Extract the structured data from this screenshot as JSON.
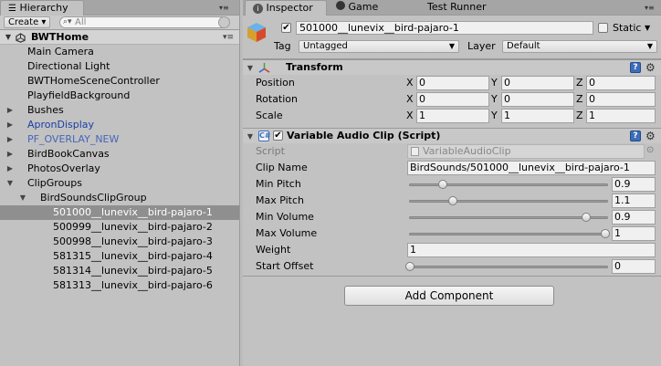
{
  "hierarchy": {
    "tab_label": "Hierarchy",
    "create_label": "Create ▾",
    "search_placeholder": "All",
    "scene_name": "BWTHome",
    "items": [
      {
        "label": "Main Camera",
        "indent": 1,
        "arrow": "",
        "color": "normal",
        "selected": false
      },
      {
        "label": "Directional Light",
        "indent": 1,
        "arrow": "",
        "color": "normal",
        "selected": false
      },
      {
        "label": "BWTHomeSceneController",
        "indent": 1,
        "arrow": "",
        "color": "normal",
        "selected": false
      },
      {
        "label": "PlayfieldBackground",
        "indent": 1,
        "arrow": "",
        "color": "normal",
        "selected": false
      },
      {
        "label": "Bushes",
        "indent": 1,
        "arrow": "▶",
        "color": "normal",
        "selected": false
      },
      {
        "label": "ApronDisplay",
        "indent": 1,
        "arrow": "▶",
        "color": "blue",
        "selected": false
      },
      {
        "label": "PF_OVERLAY_NEW",
        "indent": 1,
        "arrow": "▶",
        "color": "dimblue",
        "selected": false
      },
      {
        "label": "BirdBookCanvas",
        "indent": 1,
        "arrow": "▶",
        "color": "normal",
        "selected": false
      },
      {
        "label": "PhotosOverlay",
        "indent": 1,
        "arrow": "▶",
        "color": "normal",
        "selected": false
      },
      {
        "label": "ClipGroups",
        "indent": 1,
        "arrow": "▼",
        "color": "normal",
        "selected": false
      },
      {
        "label": "BirdSoundsClipGroup",
        "indent": 2,
        "arrow": "▼",
        "color": "normal",
        "selected": false
      },
      {
        "label": "501000__lunevix__bird-pajaro-1",
        "indent": 3,
        "arrow": "",
        "color": "normal",
        "selected": true
      },
      {
        "label": "500999__lunevix__bird-pajaro-2",
        "indent": 3,
        "arrow": "",
        "color": "normal",
        "selected": false
      },
      {
        "label": "500998__lunevix__bird-pajaro-3",
        "indent": 3,
        "arrow": "",
        "color": "normal",
        "selected": false
      },
      {
        "label": "581315__lunevix__bird-pajaro-4",
        "indent": 3,
        "arrow": "",
        "color": "normal",
        "selected": false
      },
      {
        "label": "581314__lunevix__bird-pajaro-5",
        "indent": 3,
        "arrow": "",
        "color": "normal",
        "selected": false
      },
      {
        "label": "581313__lunevix__bird-pajaro-6",
        "indent": 3,
        "arrow": "",
        "color": "normal",
        "selected": false
      }
    ]
  },
  "tabs": {
    "inspector": "Inspector",
    "game": "Game",
    "test_runner": "Test Runner"
  },
  "object": {
    "active": true,
    "name": "501000__lunevix__bird-pajaro-1",
    "static_label": "Static",
    "static_checked": false,
    "tag_label": "Tag",
    "tag_value": "Untagged",
    "layer_label": "Layer",
    "layer_value": "Default"
  },
  "transform": {
    "title": "Transform",
    "position_label": "Position",
    "rotation_label": "Rotation",
    "scale_label": "Scale",
    "x_label": "X",
    "y_label": "Y",
    "z_label": "Z",
    "position": {
      "x": "0",
      "y": "0",
      "z": "0"
    },
    "rotation": {
      "x": "0",
      "y": "0",
      "z": "0"
    },
    "scale": {
      "x": "1",
      "y": "1",
      "z": "1"
    }
  },
  "audio_clip": {
    "title": "Variable Audio Clip (Script)",
    "enabled": true,
    "script_label": "Script",
    "script_value": "VariableAudioClip",
    "clip_name_label": "Clip Name",
    "clip_name_value": "BirdSounds/501000__lunevix__bird-pajaro-1",
    "sliders": [
      {
        "label": "Min Pitch",
        "value": "0.9",
        "fraction": 0.17
      },
      {
        "label": "Max Pitch",
        "value": "1.1",
        "fraction": 0.22
      },
      {
        "label": "Min Volume",
        "value": "0.9",
        "fraction": 0.9
      },
      {
        "label": "Max Volume",
        "value": "1",
        "fraction": 1.0
      }
    ],
    "weight_label": "Weight",
    "weight_value": "1",
    "start_offset_label": "Start Offset",
    "start_offset_value": "0",
    "start_offset_fraction": 0.0
  },
  "add_component_label": "Add Component"
}
